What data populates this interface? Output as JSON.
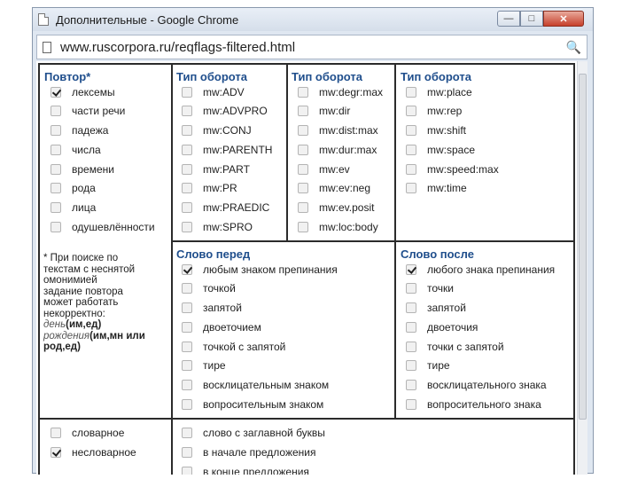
{
  "window": {
    "title": "Дополнительные - Google Chrome"
  },
  "address_bar": {
    "url": "www.ruscorpora.ru/reqflags-filtered.html"
  },
  "repeat": {
    "header": "Повтор*",
    "items": [
      {
        "label": "лексемы",
        "checked": true
      },
      {
        "label": "части речи",
        "checked": false
      },
      {
        "label": "падежа",
        "checked": false
      },
      {
        "label": "числа",
        "checked": false
      },
      {
        "label": "времени",
        "checked": false
      },
      {
        "label": "рода",
        "checked": false
      },
      {
        "label": "лица",
        "checked": false
      },
      {
        "label": "одушевлённости",
        "checked": false
      }
    ],
    "note": {
      "line1": "* При поиске по",
      "line2": "текстам с неснятой",
      "line3": "омонимией",
      "line4": "задание повтора",
      "line5": "может работать",
      "line6": "некорректно:",
      "ex1_word": "день",
      "ex1_tags": "(им,ед)",
      "ex2_word": "рождения",
      "ex2_tags": "(им,мн или",
      "ex2_end": "род,ед)"
    }
  },
  "turnover_col1": {
    "header": "Тип оборота",
    "items": [
      {
        "label": "mw:ADV"
      },
      {
        "label": "mw:ADVPRO"
      },
      {
        "label": "mw:CONJ"
      },
      {
        "label": "mw:PARENTH"
      },
      {
        "label": "mw:PART"
      },
      {
        "label": "mw:PR"
      },
      {
        "label": "mw:PRAEDIC"
      },
      {
        "label": "mw:SPRO"
      }
    ]
  },
  "turnover_col2": {
    "header": "Тип оборота",
    "items": [
      {
        "label": "mw:degr:max"
      },
      {
        "label": "mw:dir"
      },
      {
        "label": "mw:dist:max"
      },
      {
        "label": "mw:dur:max"
      },
      {
        "label": "mw:ev"
      },
      {
        "label": "mw:ev:neg"
      },
      {
        "label": "mw:ev.posit"
      },
      {
        "label": "mw:loc:body"
      }
    ]
  },
  "turnover_col3": {
    "header": "Тип оборота",
    "items": [
      {
        "label": "mw:place"
      },
      {
        "label": "mw:rep"
      },
      {
        "label": "mw:shift"
      },
      {
        "label": "mw:space"
      },
      {
        "label": "mw:speed:max"
      },
      {
        "label": "mw:time"
      }
    ]
  },
  "word_before": {
    "header": "Слово перед",
    "items": [
      {
        "label": "любым знаком препинания",
        "checked": true
      },
      {
        "label": "точкой",
        "checked": false
      },
      {
        "label": "запятой",
        "checked": false
      },
      {
        "label": "двоеточием",
        "checked": false
      },
      {
        "label": "точкой с запятой",
        "checked": false
      },
      {
        "label": "тире",
        "checked": false
      },
      {
        "label": "восклицательным знаком",
        "checked": false
      },
      {
        "label": "вопросительным знаком",
        "checked": false
      }
    ]
  },
  "word_after": {
    "header": "Слово после",
    "items": [
      {
        "label": "любого знака препинания",
        "checked": true
      },
      {
        "label": "точки",
        "checked": false
      },
      {
        "label": "запятой",
        "checked": false
      },
      {
        "label": "двоеточия",
        "checked": false
      },
      {
        "label": "точки с запятой",
        "checked": false
      },
      {
        "label": "тире",
        "checked": false
      },
      {
        "label": "восклицательного знака",
        "checked": false
      },
      {
        "label": "вопросительного знака",
        "checked": false
      }
    ]
  },
  "dict": {
    "items": [
      {
        "label": "словарное",
        "checked": false
      },
      {
        "label": "несловарное",
        "checked": true
      }
    ]
  },
  "sentence": {
    "items": [
      {
        "label": "слово с заглавной буквы"
      },
      {
        "label": "в начале предложения"
      },
      {
        "label": "в конце предложения"
      }
    ]
  }
}
